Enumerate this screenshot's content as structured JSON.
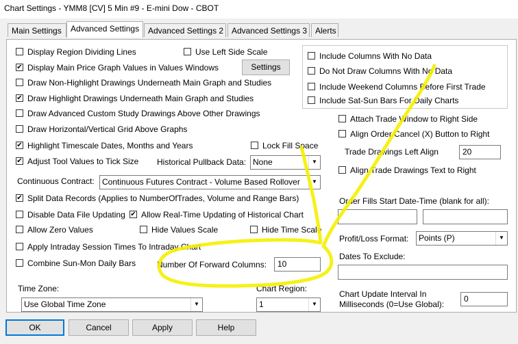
{
  "window": {
    "title": "Chart Settings - YMM8 [CV]  5 Min  #9 - E-mini Dow - CBOT"
  },
  "tabs": [
    {
      "label": "Main Settings",
      "active": false
    },
    {
      "label": "Advanced Settings",
      "active": true
    },
    {
      "label": "Advanced Settings 2",
      "active": false
    },
    {
      "label": "Advanced Settings 3",
      "active": false
    },
    {
      "label": "Alerts",
      "active": false
    }
  ],
  "left": {
    "display_region_dividing_lines": {
      "label": "Display Region Dividing Lines",
      "checked": false
    },
    "use_left_side_scale": {
      "label": "Use Left Side Scale",
      "checked": false
    },
    "display_main_price_graph_values": {
      "label": "Display Main Price Graph Values in Values Windows",
      "checked": true
    },
    "settings_button": "Settings",
    "draw_non_highlight": {
      "label": "Draw Non-Highlight Drawings Underneath Main Graph and Studies",
      "checked": false
    },
    "draw_highlight": {
      "label": "Draw Highlight Drawings Underneath Main Graph and Studies",
      "checked": true
    },
    "draw_advanced_custom": {
      "label": "Draw Advanced Custom Study Drawings Above Other Drawings",
      "checked": false
    },
    "draw_grid_above": {
      "label": "Draw Horizontal/Vertical Grid Above Graphs",
      "checked": false
    },
    "highlight_timescale": {
      "label": "Highlight Timescale Dates, Months and Years",
      "checked": true
    },
    "lock_fill_space": {
      "label": "Lock Fill Space",
      "checked": false
    },
    "adjust_tool_values": {
      "label": "Adjust Tool Values to Tick Size",
      "checked": true
    },
    "historical_pullback_label": "Historical Pullback Data:",
    "historical_pullback_value": "None",
    "continuous_contract_label": "Continuous Contract:",
    "continuous_contract_value": "Continuous Futures Contract - Volume Based Rollover",
    "split_data_records": {
      "label": "Split Data Records (Applies to NumberOfTrades, Volume and Range Bars)",
      "checked": true
    },
    "disable_data_file_updating": {
      "label": "Disable Data File Updating",
      "checked": false
    },
    "allow_realtime_updating": {
      "label": "Allow Real-Time Updating of Historical Chart",
      "checked": true
    },
    "allow_zero_values": {
      "label": "Allow Zero Values",
      "checked": false
    },
    "hide_values_scale": {
      "label": "Hide Values Scale",
      "checked": false
    },
    "hide_time_scale": {
      "label": "Hide Time Scale",
      "checked": false
    },
    "apply_intraday_session": {
      "label": "Apply Intraday Session Times To Intraday Chart",
      "checked": false
    },
    "combine_sun_mon": {
      "label": "Combine Sun-Mon Daily Bars",
      "checked": false
    },
    "number_forward_columns_label": "Number Of Forward Columns:",
    "number_forward_columns_value": "10",
    "time_zone_label": "Time Zone:",
    "time_zone_value": "Use Global Time Zone",
    "chart_region_label": "Chart Region:",
    "chart_region_value": "1"
  },
  "right": {
    "include_columns_no_data": {
      "label": "Include Columns With No Data",
      "checked": false
    },
    "do_not_draw_columns": {
      "label": "Do Not Draw Columns With No Data",
      "checked": false
    },
    "include_weekend_columns": {
      "label": "Include Weekend Columns Before First Trade",
      "checked": false
    },
    "include_sat_sun_bars": {
      "label": "Include Sat-Sun Bars For Daily Charts",
      "checked": false
    },
    "attach_trade_window": {
      "label": "Attach Trade Window to Right Side",
      "checked": false
    },
    "align_order_cancel": {
      "label": "Align Order Cancel (X) Button to Right",
      "checked": false
    },
    "trade_drawings_left_align_label": "Trade Drawings Left Align",
    "trade_drawings_left_align_value": "20",
    "align_trade_drawings_text": {
      "label": "Align Trade Drawings Text to Right",
      "checked": false
    },
    "order_fills_start_label": "Order Fills Start Date-Time (blank for all):",
    "order_fills_start_date": "",
    "order_fills_start_time": "",
    "profit_loss_format_label": "Profit/Loss Format:",
    "profit_loss_format_value": "Points (P)",
    "dates_to_exclude_label": "Dates To Exclude:",
    "dates_to_exclude_value": "",
    "chart_update_interval_label_1": "Chart Update Interval In",
    "chart_update_interval_label_2": "Milliseconds (0=Use Global):",
    "chart_update_interval_value": "0"
  },
  "buttons": {
    "ok": "OK",
    "cancel": "Cancel",
    "apply": "Apply",
    "help": "Help"
  },
  "check_glyph": "✔",
  "colors": {
    "annotation": "#f5f000",
    "accent": "#0078d7"
  }
}
